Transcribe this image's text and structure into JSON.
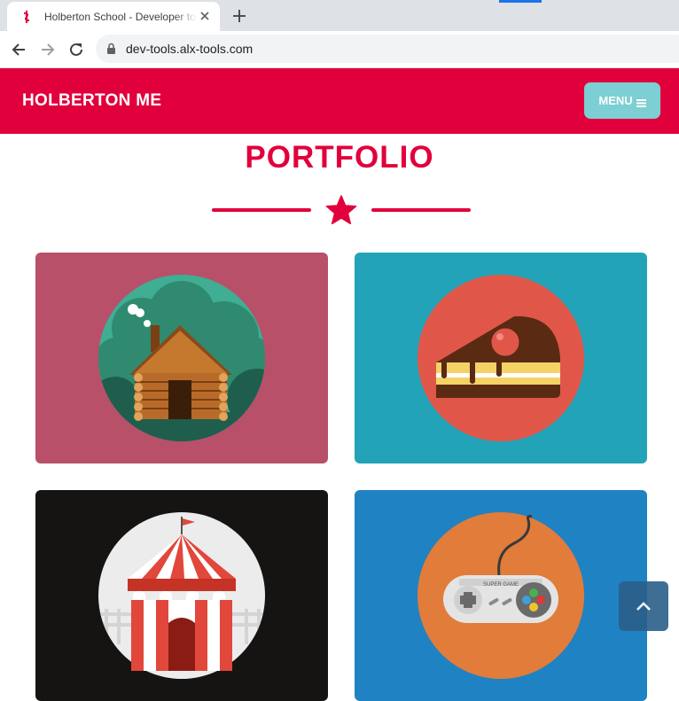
{
  "browser": {
    "tab_title": "Holberton School - Developer tools",
    "url": "dev-tools.alx-tools.com"
  },
  "header": {
    "brand": "HOLBERTON ME",
    "menu_label": "MENU"
  },
  "portfolio": {
    "title": "PORTFOLIO",
    "items": [
      {
        "name": "cabin",
        "bg": "#b8506a"
      },
      {
        "name": "cake",
        "bg": "#22a3b8"
      },
      {
        "name": "circus-tent",
        "bg": "#161313"
      },
      {
        "name": "game-controller",
        "bg": "#1f82c2",
        "label": "SUPER GAME"
      }
    ]
  },
  "colors": {
    "accent": "#e1003c",
    "menu_button": "#7ccfd3",
    "to_top": "#2b5f8a"
  }
}
